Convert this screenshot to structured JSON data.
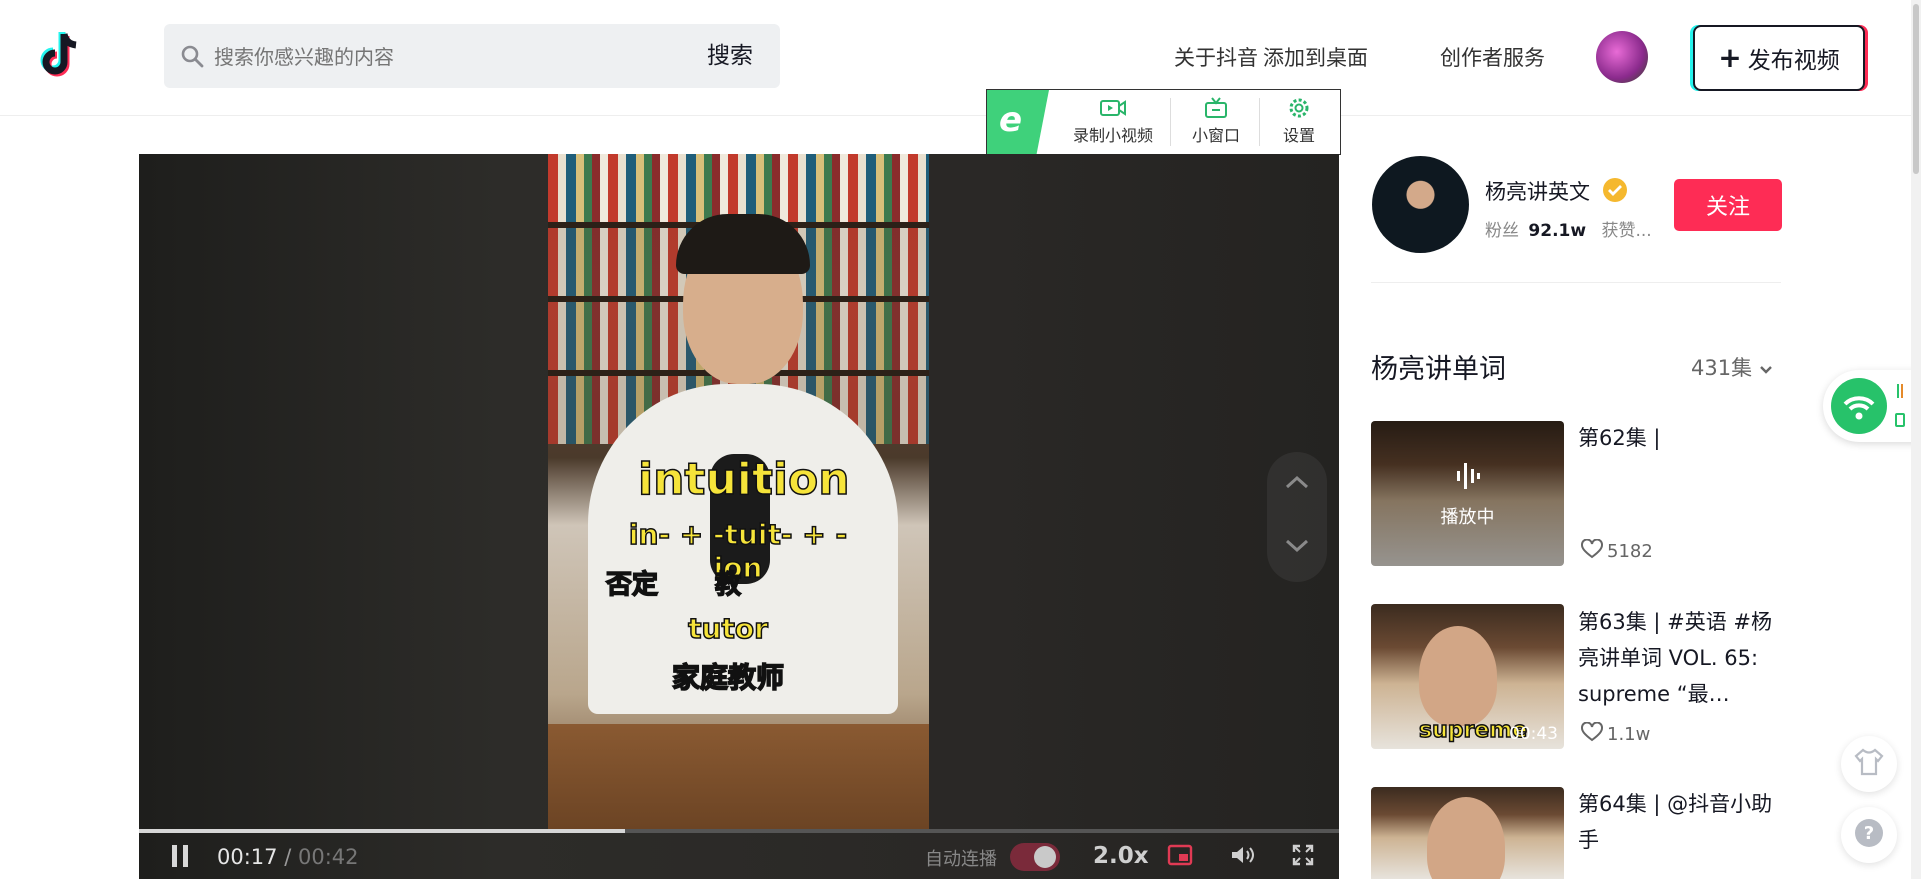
{
  "header": {
    "search_placeholder": "搜索你感兴趣的内容",
    "search_button": "搜索",
    "nav": [
      "关于抖音",
      "添加到桌面",
      "创作者服务"
    ],
    "publish_label": "发布视频"
  },
  "ext_toolbar": {
    "record_label": "录制小视频",
    "mini_window_label": "小窗口",
    "settings_label": "设置"
  },
  "video": {
    "captions": {
      "word": "intuition",
      "morphemes": "in- + -tuit- + -ion",
      "gloss_left": "否定",
      "gloss_mid": "教",
      "related": "tutor",
      "related_gloss": "家庭教师"
    },
    "progress": 0.405,
    "current_time": "00:17",
    "separator": "/",
    "duration": "00:42",
    "autoplay_label": "自动连播",
    "speed": "2.0x"
  },
  "author": {
    "name": "杨亮讲英文",
    "fans_label": "粉丝",
    "fans_count": "92.1w",
    "likes_label": "获赞...",
    "follow_label": "关注"
  },
  "collection": {
    "title": "杨亮讲单词",
    "count": "431集",
    "episodes": [
      {
        "title": "第62集 |",
        "playing_label": "播放中",
        "likes": "5182"
      },
      {
        "title": "第63集 | #英语 #杨亮讲单词 VOL. 65: supreme “最…",
        "thumb_caption": "supreme",
        "duration": "00:43",
        "likes": "1.1w"
      },
      {
        "title": "第64集 | @抖音小助手"
      }
    ]
  },
  "colors": {
    "accent": "#fe2c55",
    "toolbar_green": "#3fd17b",
    "caption_yellow": "#f6e43a"
  }
}
